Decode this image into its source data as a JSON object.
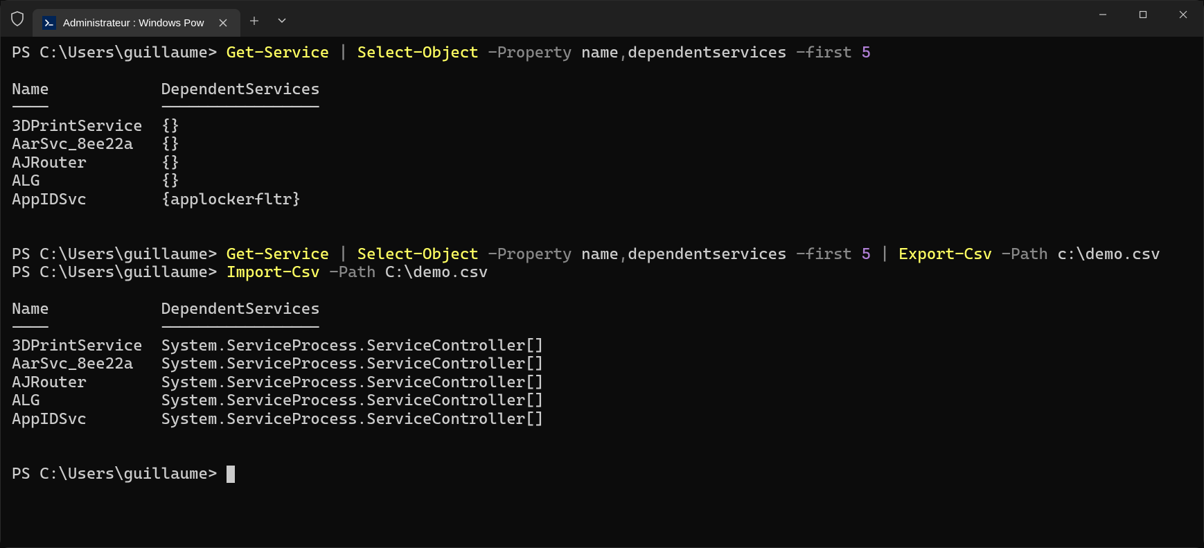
{
  "window": {
    "tab_title": "Administrateur : Windows Pow"
  },
  "prompt_text": "PS C:\\Users\\guillaume> ",
  "cmdline1": {
    "cmdlet1": "Get-Service",
    "pipe": " | ",
    "cmdlet2": "Select-Object",
    "param1": " -Property ",
    "arg1": "name",
    "comma": ",",
    "arg2": "dependentservices",
    "param2": " -first ",
    "num": "5"
  },
  "table1": {
    "header_name": "Name",
    "header_dep": "DependentServices",
    "sep_name": "----",
    "sep_dep": "-----------------",
    "rows": [
      {
        "name": "3DPrintService",
        "dep": "{}"
      },
      {
        "name": "AarSvc_8ee22a",
        "dep": "{}"
      },
      {
        "name": "AJRouter",
        "dep": "{}"
      },
      {
        "name": "ALG",
        "dep": "{}"
      },
      {
        "name": "AppIDSvc",
        "dep": "{applockerfltr}"
      }
    ]
  },
  "cmdline2": {
    "cmdlet1": "Get-Service",
    "pipe": " | ",
    "cmdlet2": "Select-Object",
    "param1": " -Property ",
    "arg1": "name",
    "comma": ",",
    "arg2": "dependentservices",
    "param2": " -first ",
    "num": "5",
    "pipe2": " | ",
    "cmdlet3": "Export-Csv",
    "param3": " -Path ",
    "path": "c:\\demo.csv"
  },
  "cmdline3": {
    "cmdlet1": "Import-Csv",
    "param1": " -Path ",
    "path": "C:\\demo.csv"
  },
  "table2": {
    "header_name": "Name",
    "header_dep": "DependentServices",
    "sep_name": "----",
    "sep_dep": "-----------------",
    "rows": [
      {
        "name": "3DPrintService",
        "dep": "System.ServiceProcess.ServiceController[]"
      },
      {
        "name": "AarSvc_8ee22a",
        "dep": "System.ServiceProcess.ServiceController[]"
      },
      {
        "name": "AJRouter",
        "dep": "System.ServiceProcess.ServiceController[]"
      },
      {
        "name": "ALG",
        "dep": "System.ServiceProcess.ServiceController[]"
      },
      {
        "name": "AppIDSvc",
        "dep": "System.ServiceProcess.ServiceController[]"
      }
    ]
  },
  "col_width_name": 15
}
